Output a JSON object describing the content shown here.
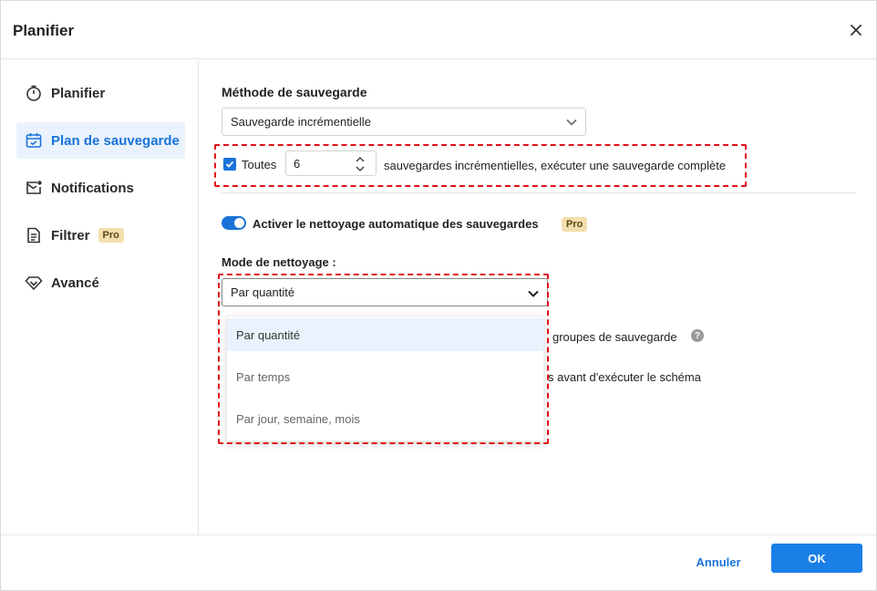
{
  "dialog": {
    "title": "Planifier",
    "close_icon": "close-icon"
  },
  "sidebar": {
    "items": [
      {
        "label": "Planifier",
        "icon": "stopwatch-icon",
        "active": false,
        "pro": false
      },
      {
        "label": "Plan de sauvegarde",
        "icon": "calendar-check-icon",
        "active": true,
        "pro": false
      },
      {
        "label": "Notifications",
        "icon": "mail-icon",
        "active": false,
        "pro": false
      },
      {
        "label": "Filtrer",
        "icon": "filter-document-icon",
        "active": false,
        "pro": true,
        "badge": "Pro"
      },
      {
        "label": "Avancé",
        "icon": "diamond-icon",
        "active": false,
        "pro": false
      }
    ]
  },
  "backup_method": {
    "label": "Méthode de sauvegarde",
    "selected": "Sauvegarde incrémentielle",
    "every_checked": true,
    "every_label": "Toutes",
    "every_value": "6",
    "every_suffix": "sauvegardes incrémentielles, exécuter une sauvegarde complète"
  },
  "cleanup": {
    "toggle_on": true,
    "toggle_label": "Activer le nettoyage automatique des sauvegardes",
    "badge": "Pro",
    "mode_label": "Mode de nettoyage :",
    "mode_selected": "Par quantité",
    "options": [
      "Par quantité",
      "Par temps",
      "Par jour, semaine, mois"
    ],
    "hidden_text_1": "groupes de sauvegarde",
    "hidden_text_2": "s avant d'exécuter le schéma"
  },
  "footer": {
    "cancel_label": "Annuler",
    "ok_label": "OK"
  },
  "colors": {
    "accent": "#1a73d9",
    "highlight_box": "#e0121a",
    "pro_badge": "#f3dfae"
  }
}
